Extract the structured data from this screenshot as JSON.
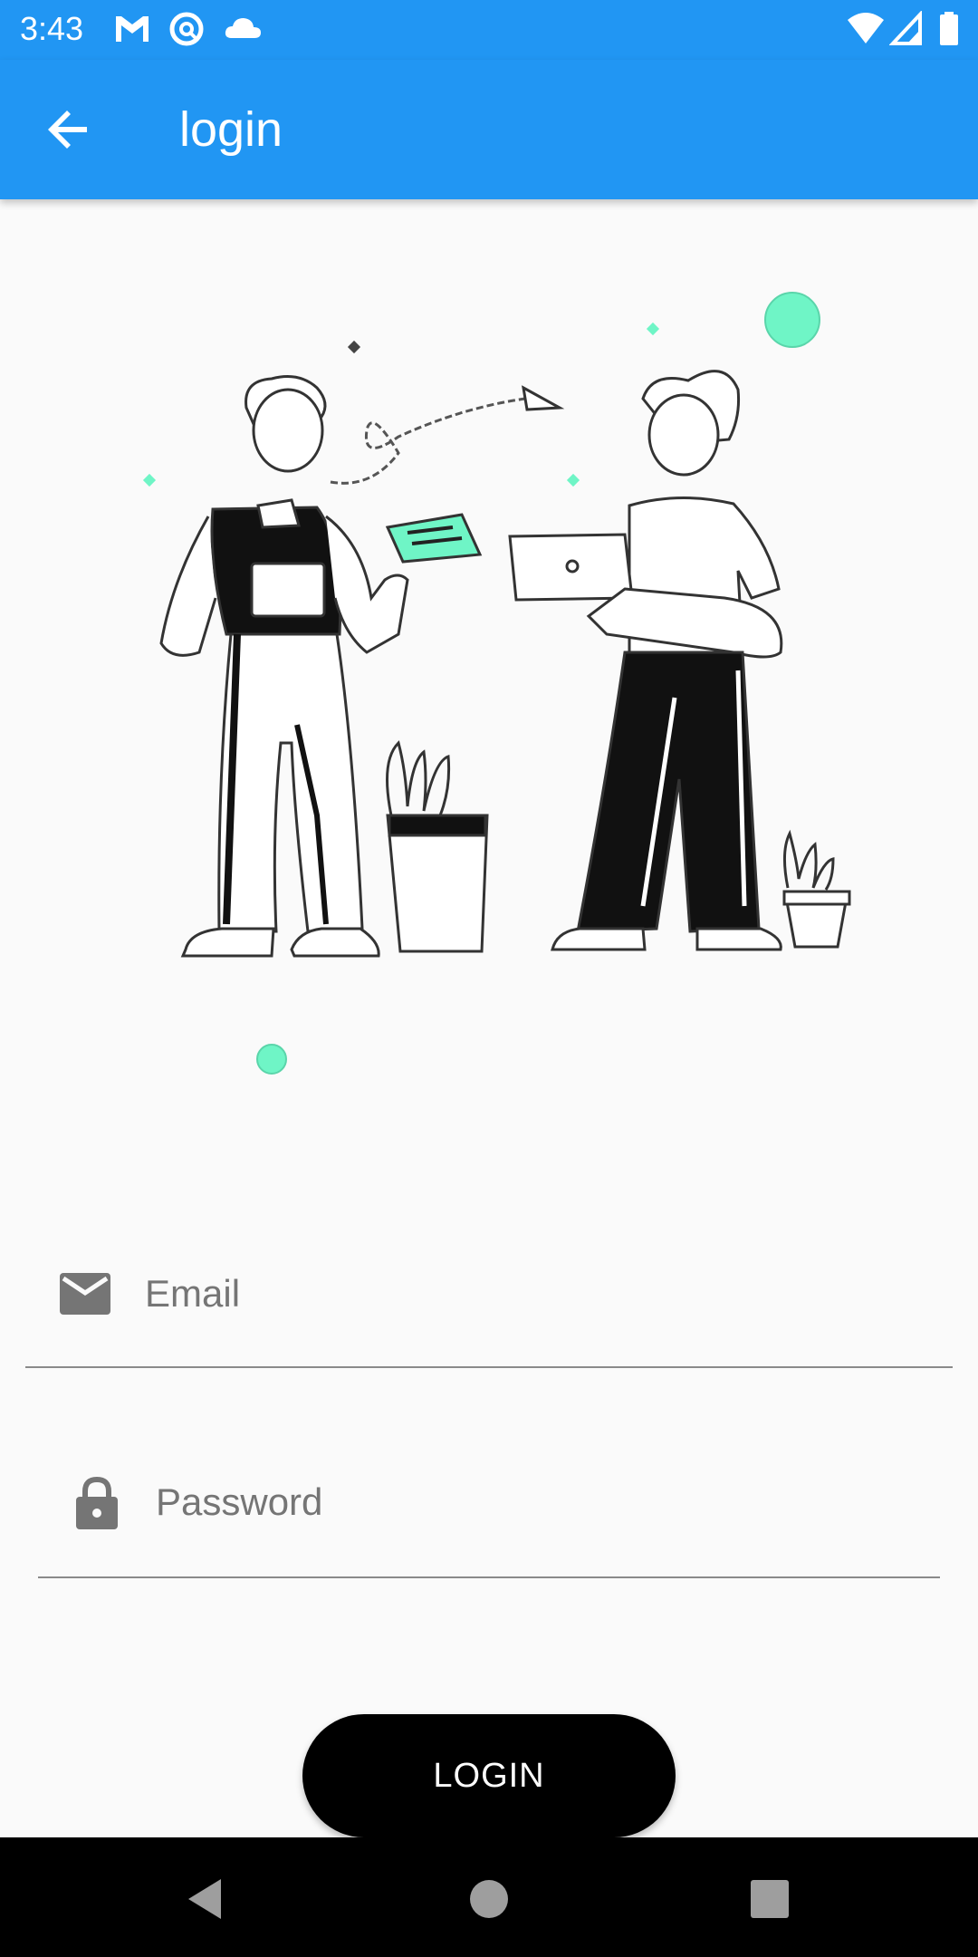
{
  "status_bar": {
    "time": "3:43",
    "left_icons": [
      "gmail-icon",
      "sync-icon",
      "cloud-icon"
    ],
    "right_icons": [
      "wifi-icon",
      "cell-signal-icon",
      "battery-icon"
    ]
  },
  "app_bar": {
    "title": "login",
    "back_icon": "arrow-back-icon",
    "color": "#2196f3"
  },
  "illustration": {
    "icon": "people-illustration",
    "accent_color": "#6ff5c6"
  },
  "form": {
    "email": {
      "placeholder": "Email",
      "icon": "mail-icon"
    },
    "password": {
      "placeholder": "Password",
      "icon": "lock-icon"
    }
  },
  "login_button": {
    "label": "LOGIN"
  },
  "nav_bar": {
    "icons": [
      "back-triangle-icon",
      "home-circle-icon",
      "recents-square-icon"
    ]
  }
}
